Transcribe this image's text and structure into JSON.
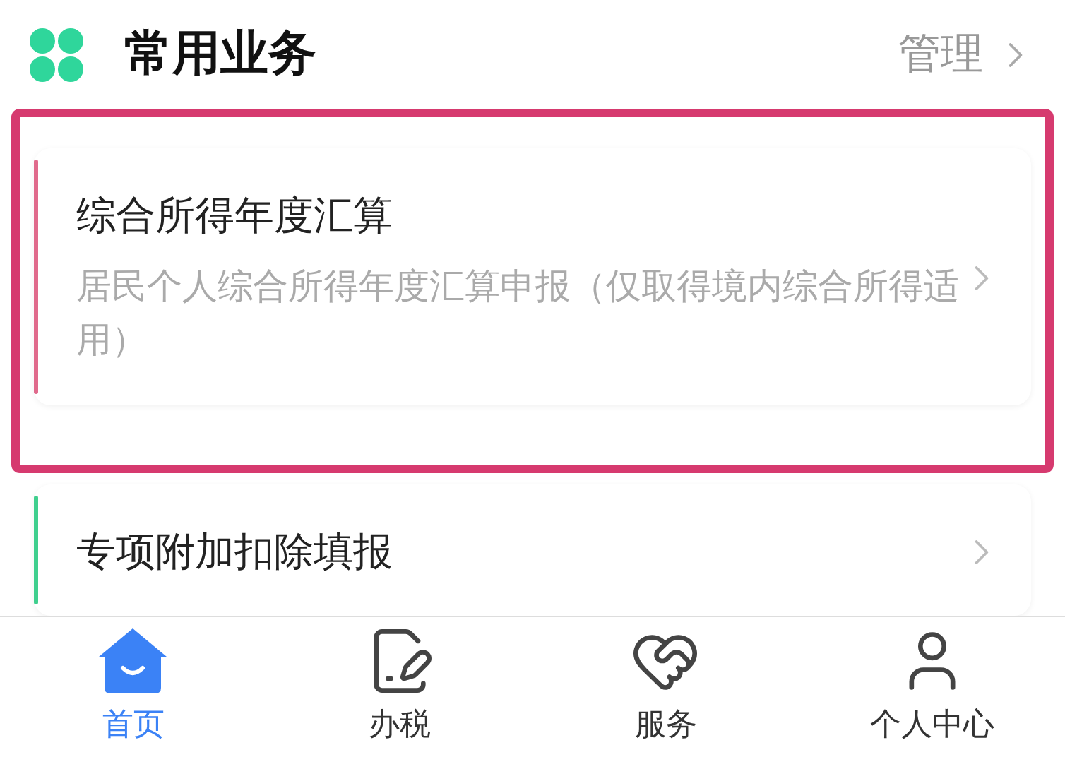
{
  "header": {
    "title": "常用业务",
    "action": "管理"
  },
  "cards": [
    {
      "title": "综合所得年度汇算",
      "subtitle": "居民个人综合所得年度汇算申报（仅取得境内综合所得适用）",
      "color": "#e06a8c",
      "highlighted": true
    },
    {
      "title": "专项附加扣除填报",
      "color": "#3fcf8e",
      "highlighted": false
    }
  ],
  "tabs": [
    {
      "label": "首页",
      "kind": "home",
      "selected": true
    },
    {
      "label": "办税",
      "kind": "tax",
      "selected": false
    },
    {
      "label": "服务",
      "kind": "service",
      "selected": false
    },
    {
      "label": "个人中心",
      "kind": "profile",
      "selected": false
    }
  ]
}
